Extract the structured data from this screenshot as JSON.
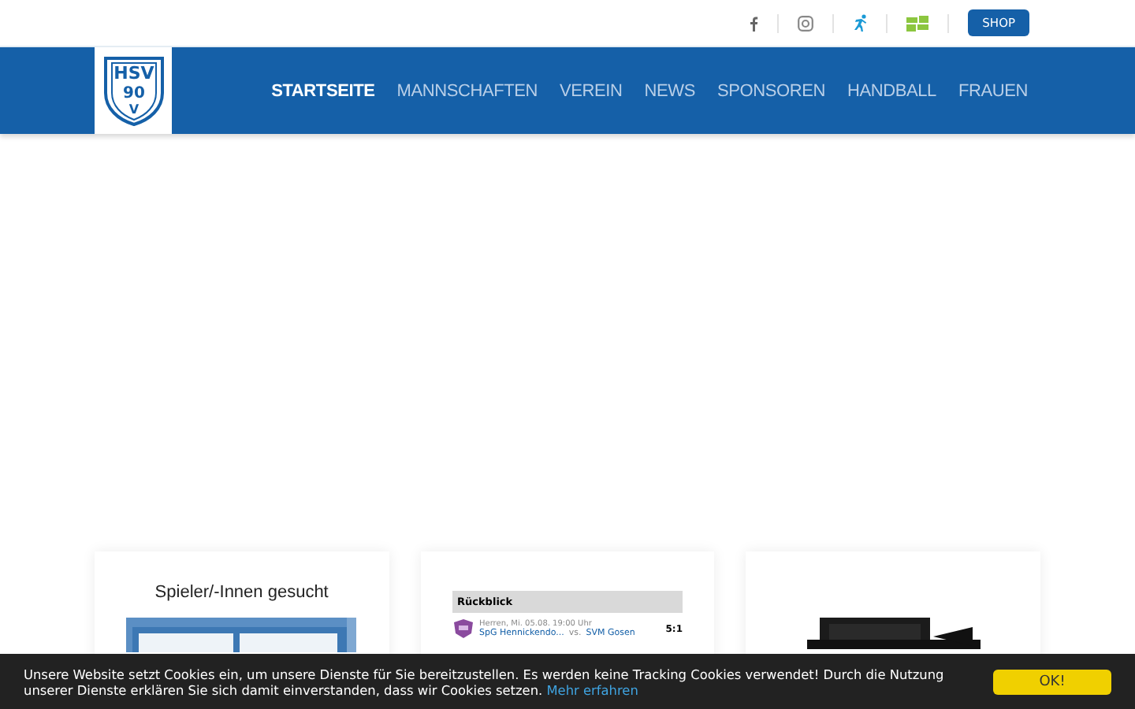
{
  "topbar": {
    "social": [
      {
        "kind": "facebook"
      },
      {
        "kind": "instagram"
      },
      {
        "kind": "runner"
      },
      {
        "kind": "tiles"
      }
    ],
    "shop": "SHOP"
  },
  "logo": {
    "lines": [
      "HSV",
      "90",
      "V"
    ]
  },
  "nav": [
    {
      "label": "STARTSEITE",
      "selected": true
    },
    {
      "label": "MANNSCHAFTEN",
      "selected": false
    },
    {
      "label": "VEREIN",
      "selected": false
    },
    {
      "label": "NEWS",
      "selected": false
    },
    {
      "label": "SPONSOREN",
      "selected": false
    },
    {
      "label": "HANDBALL",
      "selected": false
    },
    {
      "label": "FRAUEN",
      "selected": false
    }
  ],
  "cards": [
    {
      "kind": "banner",
      "title": "Spieler/-Innen gesucht"
    },
    {
      "kind": "results",
      "heading": "Rückblick",
      "rows": [
        {
          "meta": "Herren, Mi. 05.08. 19:00 Uhr",
          "home": "SpG Hennickendo...",
          "vs": "vs.",
          "away": "SVM Gosen",
          "score": "5:1"
        }
      ]
    },
    {
      "kind": "promo"
    }
  ],
  "cookie": {
    "text": "Unsere Website setzt Cookies ein, um unsere Dienste für Sie bereitzustellen. Es werden keine Tracking Cookies verwendet! Durch die Nutzung unserer Dienste erklären Sie sich damit einverstanden, dass wir Cookies setzen.",
    "link": "Mehr erfahren",
    "button": "OK!"
  }
}
